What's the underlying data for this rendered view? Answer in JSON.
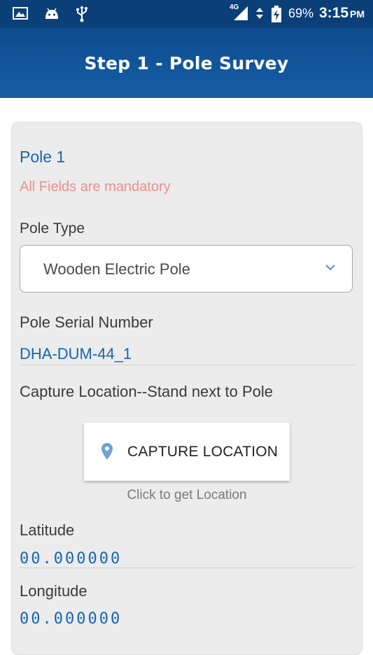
{
  "status_bar": {
    "network": "4G",
    "battery": "69%",
    "time": "3:15",
    "time_suffix": "PM",
    "icons": [
      "image-icon",
      "android-icon",
      "usb-icon",
      "signal-icon",
      "data-arrows-icon",
      "battery-charging-icon"
    ]
  },
  "header": {
    "title": "Step 1 - Pole Survey"
  },
  "form": {
    "pole_title": "Pole 1",
    "mandatory_note": "All Fields are mandatory",
    "pole_type_label": "Pole Type",
    "pole_type_value": "Wooden Electric Pole",
    "serial_label": "Pole Serial Number",
    "serial_value": "DHA-DUM-44_1",
    "capture_label": "Capture Location--Stand next to Pole",
    "capture_button": "CAPTURE LOCATION",
    "capture_hint": "Click to get Location",
    "latitude_label": "Latitude",
    "latitude_value": "00.000000",
    "longitude_label": "Longitude",
    "longitude_value": "00.000000"
  },
  "colors": {
    "header": "#165ea6",
    "status_bar": "#0a3f78",
    "accent_text": "#1565b0",
    "mandatory_text": "#ef8d8d",
    "card_bg": "#ececec"
  }
}
